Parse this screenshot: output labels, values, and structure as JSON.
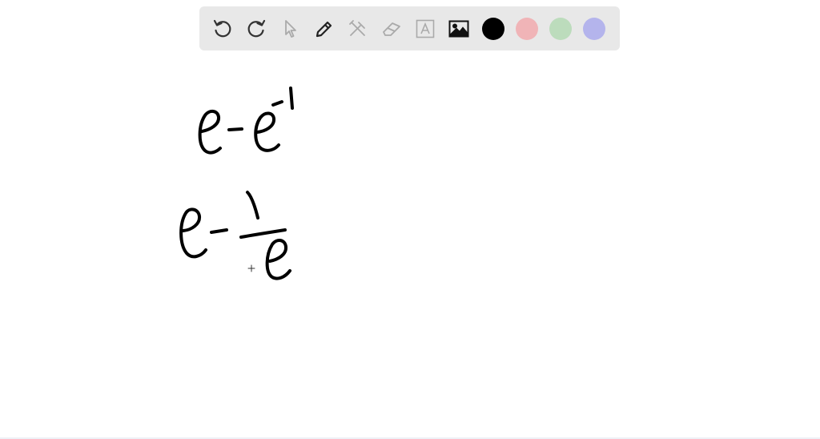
{
  "toolbar": {
    "tools": [
      {
        "name": "undo-icon",
        "enabled": true
      },
      {
        "name": "redo-icon",
        "enabled": true
      },
      {
        "name": "select-pointer-icon",
        "enabled": false
      },
      {
        "name": "pen-icon",
        "enabled": true
      },
      {
        "name": "tools-icon",
        "enabled": false
      },
      {
        "name": "eraser-icon",
        "enabled": false
      },
      {
        "name": "text-icon",
        "enabled": false
      },
      {
        "name": "image-icon",
        "enabled": true
      }
    ],
    "colors": [
      "#000000",
      "#f0b4b7",
      "#bcdcbc",
      "#b4b4ec"
    ]
  },
  "canvas": {
    "ink_color": "#000000",
    "cursor": "crosshair"
  }
}
